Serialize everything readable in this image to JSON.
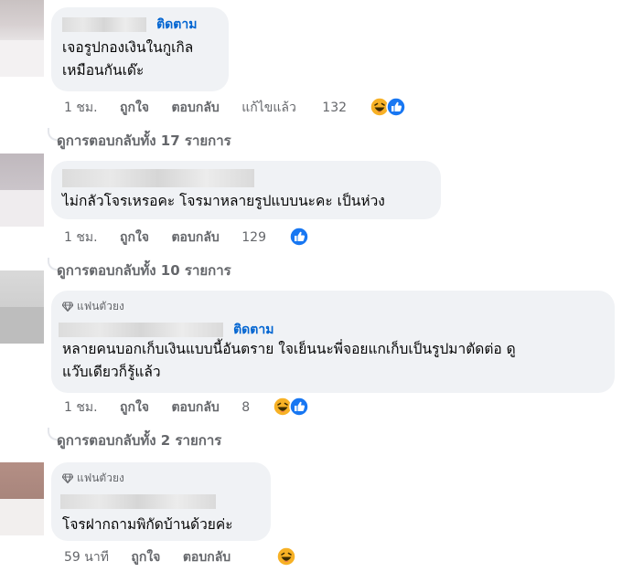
{
  "comments": [
    {
      "follow": "ติดตาม",
      "text": "เจอรูปกองเงินในกูเกิล\nเหมือนกันเด๊ะ",
      "time": "1 ชม.",
      "like": "ถูกใจ",
      "reply": "ตอบกลับ",
      "edited": "แก้ไขแล้ว",
      "reaction_count": "132",
      "reactions": [
        "haha-icon",
        "like-icon"
      ],
      "view_replies": "ดูการตอบกลับทั้ง 17 รายการ"
    },
    {
      "text": "ไม่กลัวโจรเหรอคะ โจรมาหลายรูปแบบนะคะ เป็นห่วง",
      "time": "1 ชม.",
      "like": "ถูกใจ",
      "reply": "ตอบกลับ",
      "reaction_count": "129",
      "reactions": [
        "like-icon"
      ],
      "view_replies": "ดูการตอบกลับทั้ง 10 รายการ"
    },
    {
      "badge": "แฟนตัวยง",
      "follow": "ติดตาม",
      "text": "หลายคนบอกเก็บเงินแบบนี้อันตราย ใจเย็นนะพี่จอยแกเก็บเป็นรูปมาตัดต่อ ดู\nแว๊บเดียวก็รู้แล้ว",
      "time": "1 ชม.",
      "like": "ถูกใจ",
      "reply": "ตอบกลับ",
      "reaction_count": "8",
      "reactions": [
        "haha-icon",
        "like-icon"
      ],
      "view_replies": "ดูการตอบกลับทั้ง 2 รายการ"
    },
    {
      "badge": "แฟนตัวยง",
      "text": "โจรฝากถามพิกัดบ้านด้วยค่ะ",
      "time": "59 นาที",
      "like": "ถูกใจ",
      "reply": "ตอบกลับ",
      "reactions": [
        "haha-icon"
      ]
    }
  ],
  "colors": {
    "bubble": "#f0f2f5",
    "link_blue": "#0064d1",
    "muted": "#65676b",
    "like_blue": "#1877f2",
    "haha_yellow": "#f7b125"
  }
}
